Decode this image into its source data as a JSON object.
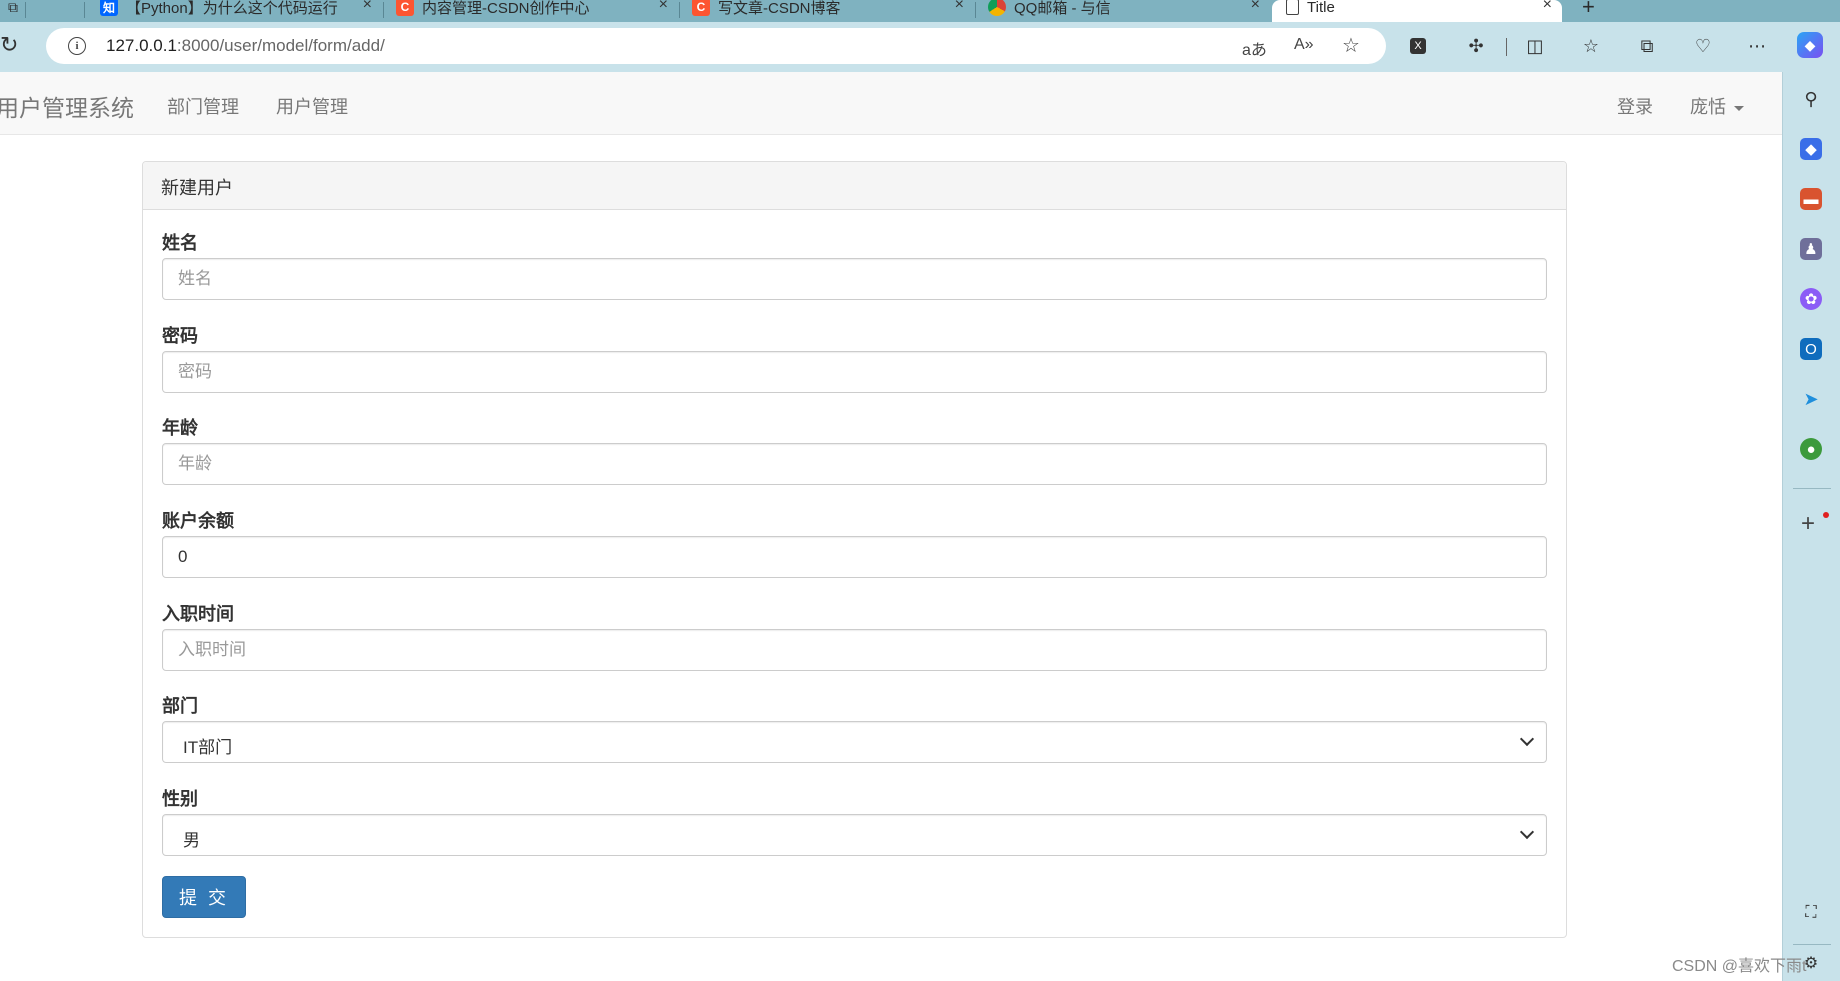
{
  "browser": {
    "tabs": [
      {
        "title": "【Python】为什么这个代码运行",
        "icon": "zhihu-icon",
        "icon_text": "知",
        "icon_color": "#0066ff"
      },
      {
        "title": "内容管理-CSDN创作中心",
        "icon": "csdn-icon",
        "icon_text": "C",
        "icon_color": "#fc5531"
      },
      {
        "title": "写文章-CSDN博客",
        "icon": "csdn-icon",
        "icon_text": "C",
        "icon_color": "#fc5531"
      },
      {
        "title": "QQ邮箱 - 与信",
        "icon": "chrome-icon",
        "icon_text": "",
        "icon_color": "#f4b400"
      },
      {
        "title": "Title",
        "icon": "page-icon",
        "icon_text": "",
        "icon_color": "#ffffff"
      }
    ],
    "url_host": "127.0.0.1",
    "url_rest": ":8000/user/model/form/add/"
  },
  "navbar": {
    "brand": "用户管理系统",
    "links": [
      "部门管理",
      "用户管理"
    ],
    "login": "登录",
    "user": "庞恬"
  },
  "form": {
    "heading": "新建用户",
    "name": {
      "label": "姓名",
      "placeholder": "姓名",
      "value": ""
    },
    "password": {
      "label": "密码",
      "placeholder": "密码",
      "value": ""
    },
    "age": {
      "label": "年龄",
      "placeholder": "年龄",
      "value": ""
    },
    "balance": {
      "label": "账户余额",
      "placeholder": "",
      "value": "0"
    },
    "create_time": {
      "label": "入职时间",
      "placeholder": "入职时间",
      "value": ""
    },
    "department": {
      "label": "部门",
      "selected": "IT部门"
    },
    "gender": {
      "label": "性别",
      "selected": "男"
    },
    "submit": "提 交"
  },
  "watermark": "CSDN @喜欢下雨t",
  "colors": {
    "primary": "#337ab7",
    "chrome": "#c8e2ea",
    "tabstrip": "#7fb2c0"
  }
}
